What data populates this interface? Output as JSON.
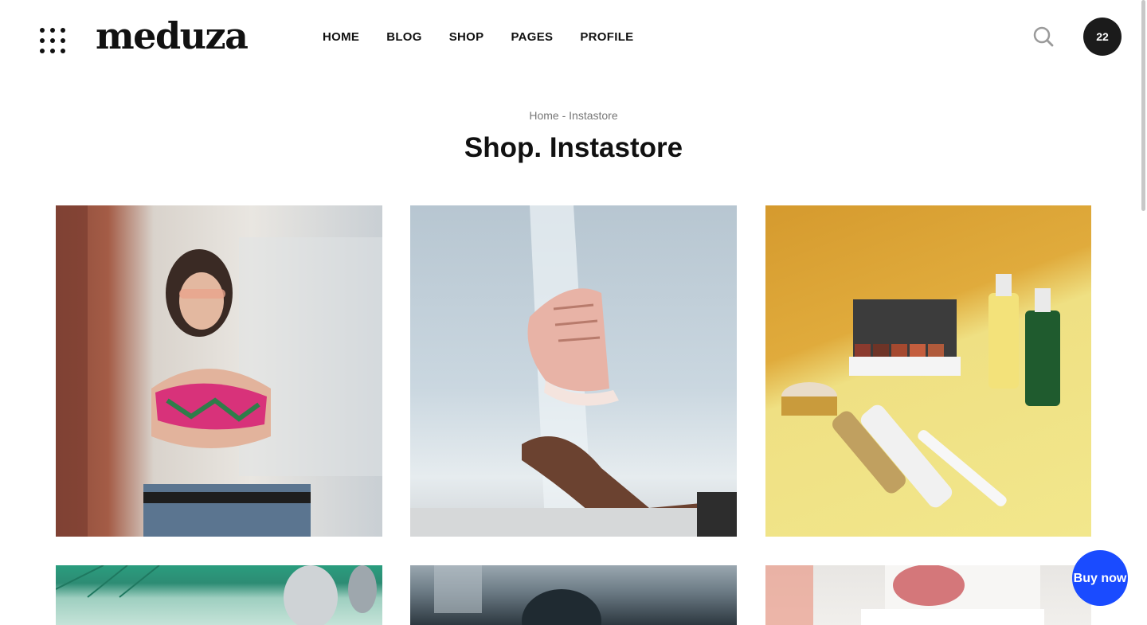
{
  "header": {
    "logo": "meduza",
    "nav": [
      "HOME",
      "BLOG",
      "SHOP",
      "PAGES",
      "PROFILE"
    ],
    "cart_count": "22"
  },
  "breadcrumb": {
    "home": "Home",
    "separator": " - ",
    "current": "Instastore"
  },
  "page_title": "Shop. Instastore",
  "products": [
    {
      "icon": "photo-woman-streetwear"
    },
    {
      "icon": "photo-pink-sneaker"
    },
    {
      "icon": "photo-cosmetics"
    },
    {
      "icon": "photo-green-tiles"
    },
    {
      "icon": "photo-woman-hair"
    },
    {
      "icon": "photo-blush-compact"
    }
  ],
  "buy_button": "Buy now",
  "colors": {
    "accent": "#1a4bff",
    "cart_bg": "#1b1b1b",
    "text": "#111111"
  }
}
